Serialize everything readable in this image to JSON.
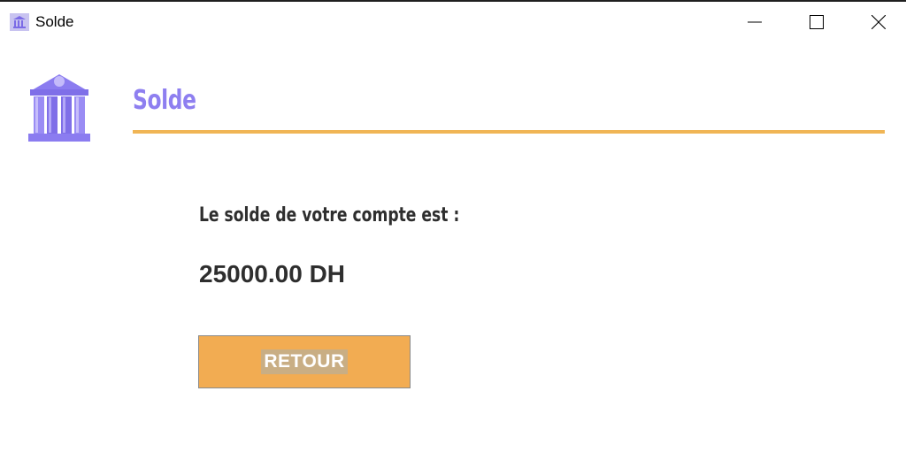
{
  "window": {
    "title": "Solde",
    "app_icon": "bank-icon",
    "controls": {
      "minimize_icon": "minimize-icon",
      "maximize_icon": "maximize-icon",
      "close_icon": "close-icon"
    }
  },
  "header": {
    "logo_icon": "bank-icon",
    "title": "Solde"
  },
  "content": {
    "balance_label": "Le solde de votre compte est :",
    "balance_value": "25000.00 DH"
  },
  "actions": {
    "retour_label": "RETOUR"
  },
  "colors": {
    "accent_purple": "#8e7ff0",
    "accent_orange": "#f0b555",
    "button_orange": "#f2ac52",
    "text_dark": "#2e2e2e"
  }
}
